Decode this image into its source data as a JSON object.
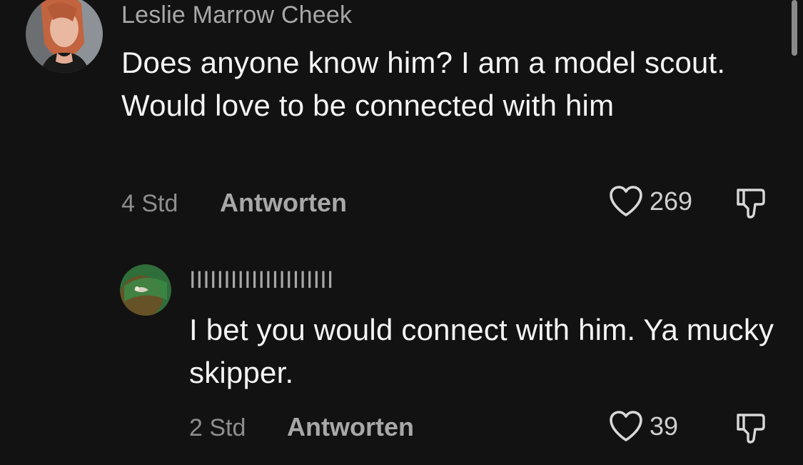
{
  "comments": [
    {
      "username": "Leslie Marrow Cheek",
      "text": "Does anyone know him? I am a model scout. Would love to be connected with him",
      "time": "4 Std",
      "reply_label": "Antworten",
      "likes": "269",
      "avatar_icon": "profile-photo"
    },
    {
      "username": "IIIIIIIIIIIIIIIIIIIII",
      "text": "I bet you would connect with him. Ya mucky skipper.",
      "time": "2 Std",
      "reply_label": "Antworten",
      "likes": "39",
      "avatar_icon": "profile-photo"
    }
  ],
  "icons": {
    "like": "heart-outline-icon",
    "dislike": "thumbs-down-icon"
  },
  "colors": {
    "background": "#121212",
    "primary_text": "#f4f4f4",
    "secondary_text": "#a8a8a8"
  }
}
